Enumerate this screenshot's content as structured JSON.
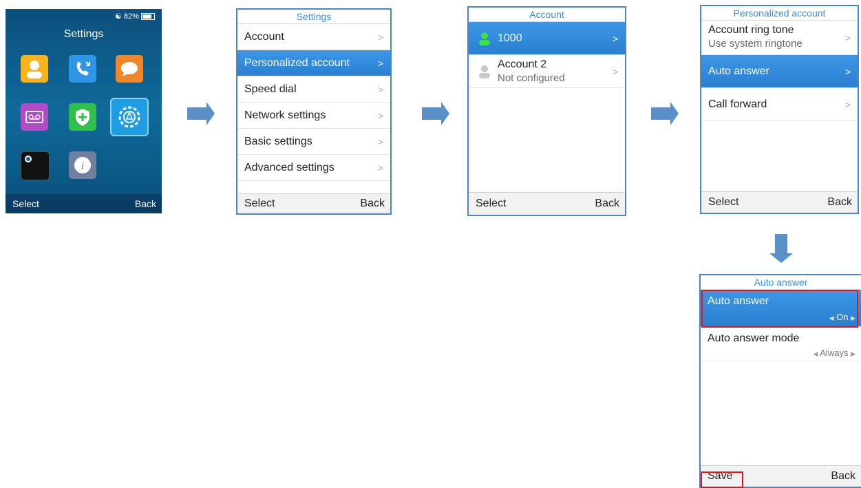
{
  "home": {
    "status": "82%",
    "title": "Settings",
    "apps": [
      "contacts-icon",
      "call-history-icon",
      "messages-icon",
      "voicemail-icon",
      "security-icon",
      "settings-gear-icon",
      "clock-icon",
      "info-icon"
    ],
    "soft_left": "Select",
    "soft_right": "Back"
  },
  "settings": {
    "title": "Settings",
    "items": [
      "Account",
      "Personalized account",
      "Speed dial",
      "Network settings",
      "Basic settings",
      "Advanced settings"
    ],
    "selected_index": 1,
    "soft_left": "Select",
    "soft_right": "Back"
  },
  "account": {
    "title": "Account",
    "items": [
      {
        "label": "1000",
        "sub": ""
      },
      {
        "label": "Account 2",
        "sub": "Not configured"
      }
    ],
    "soft_left": "Select",
    "soft_right": "Back"
  },
  "personalized": {
    "title": "Personalized account",
    "items": [
      {
        "label": "Account ring tone",
        "sub": "Use system ringtone"
      },
      {
        "label": "Auto answer",
        "sub": ""
      },
      {
        "label": "Call forward",
        "sub": ""
      }
    ],
    "soft_left": "Select",
    "soft_right": "Back"
  },
  "auto_answer": {
    "title": "Auto answer",
    "items": [
      {
        "label": "Auto answer",
        "value": "On"
      },
      {
        "label": "Auto answer mode",
        "value": "Always"
      }
    ],
    "soft_left": "Save",
    "soft_right": "Back"
  },
  "colors": {
    "accent": "#2b7fd0",
    "border": "#4a86c6",
    "highlight": "#e0161c"
  }
}
